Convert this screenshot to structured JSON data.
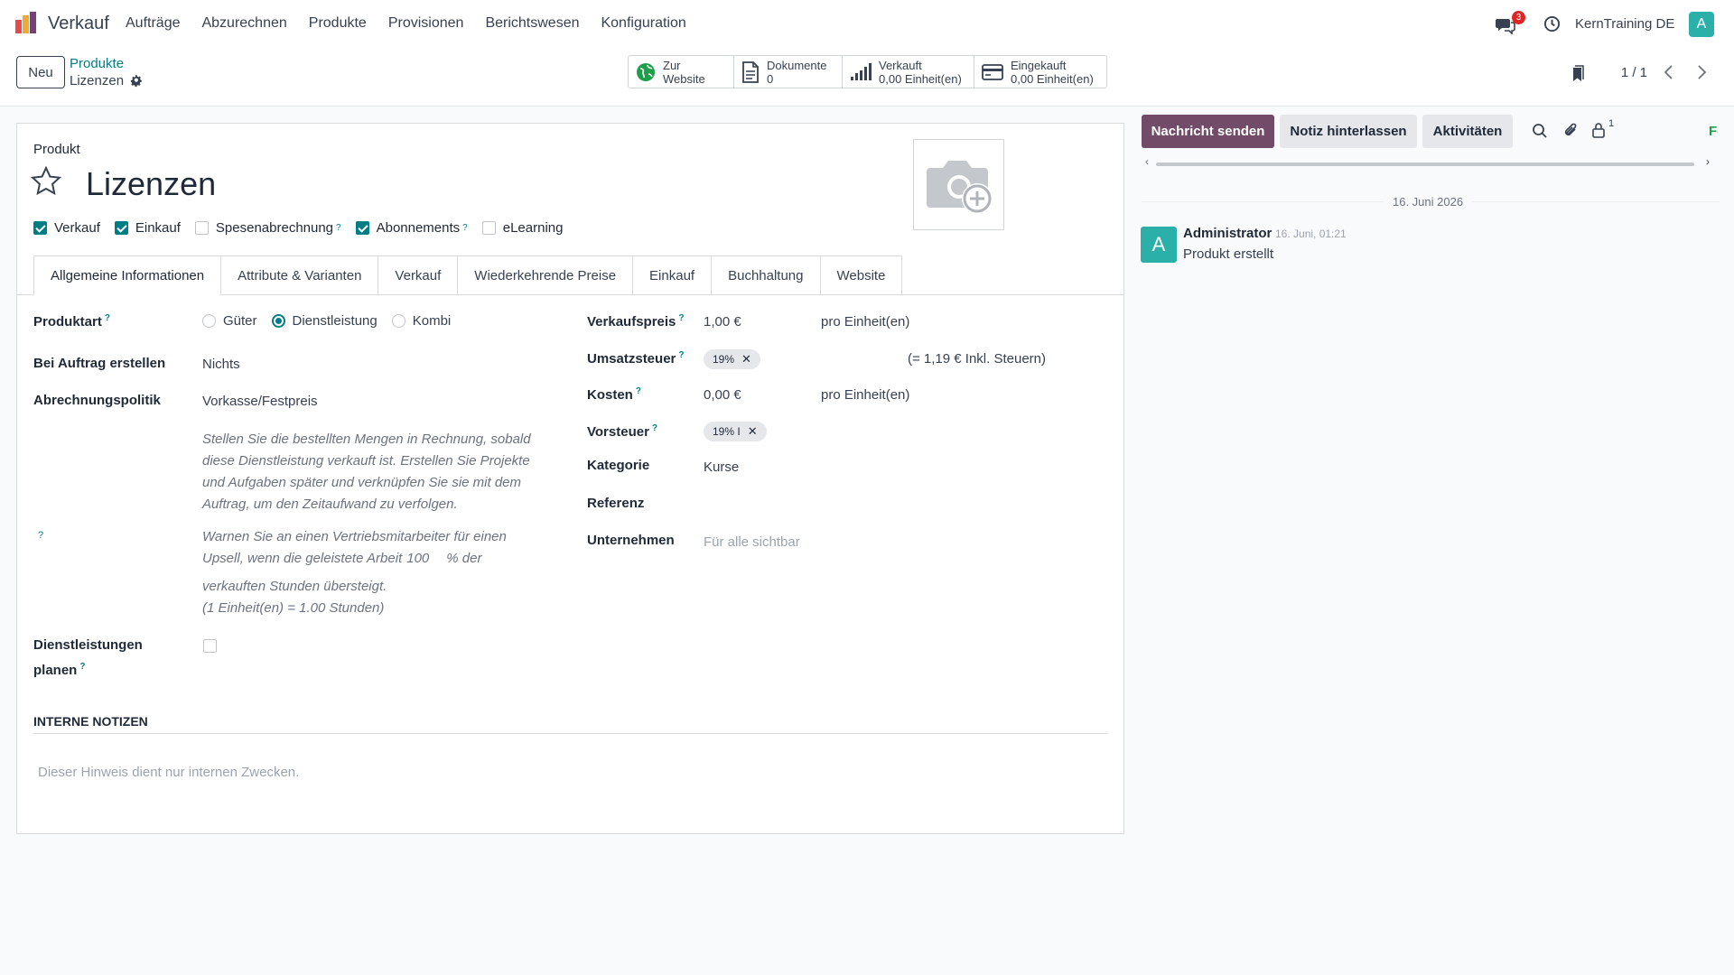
{
  "navbar": {
    "app_name": "Verkauf",
    "menu": [
      "Aufträge",
      "Abzurechnen",
      "Produkte",
      "Provisionen",
      "Berichtswesen",
      "Konfiguration"
    ],
    "messages_count": "3",
    "company": "KernTraining DE",
    "user_initial": "A",
    "icons": [
      "app-logo-icon",
      "chat-icon",
      "clock-icon"
    ]
  },
  "control": {
    "new_label": "Neu",
    "breadcrumb_parent": "Produkte",
    "breadcrumb_current": "Lizenzen",
    "smart_buttons": [
      {
        "line1": "Zur",
        "line2": "Website",
        "icon": "globe-icon"
      },
      {
        "line1": "Dokumente",
        "line2": "0",
        "icon": "document-icon"
      },
      {
        "line1": "Verkauft",
        "line2": "0,00 Einheit(en)",
        "icon": "bar-chart-icon"
      },
      {
        "line1": "Eingekauft",
        "line2": "0,00 Einheit(en)",
        "icon": "credit-card-icon"
      }
    ],
    "pager": "1 / 1"
  },
  "form": {
    "overline": "Produkt",
    "title": "Lizenzen",
    "options": [
      {
        "label": "Verkauf",
        "checked": true,
        "help": false
      },
      {
        "label": "Einkauf",
        "checked": true,
        "help": false
      },
      {
        "label": "Spesenabrechnung",
        "checked": false,
        "help": true
      },
      {
        "label": "Abonnements",
        "checked": true,
        "help": true
      },
      {
        "label": "eLearning",
        "checked": false,
        "help": false
      }
    ],
    "help_mark": "?",
    "tabs": [
      "Allgemeine Informationen",
      "Attribute & Varianten",
      "Verkauf",
      "Wiederkehrende Preise",
      "Einkauf",
      "Buchhaltung",
      "Website"
    ],
    "left": {
      "produktart_label": "Produktart",
      "produktart_options": [
        "Güter",
        "Dienstleistung",
        "Kombi"
      ],
      "produktart_selected": "Dienstleistung",
      "auftrag_label": "Bei Auftrag erstellen",
      "auftrag_value": "Nichts",
      "abrechnung_label": "Abrechnungspolitik",
      "abrechnung_value": "Vorkasse/Festpreis",
      "abrechnung_hint": [
        "Stellen Sie die bestellten Mengen in Rechnung, sobald",
        "diese Dienstleistung verkauft ist. Erstellen Sie Projekte",
        "und Aufgaben später und verknüpfen Sie sie mit dem",
        "Auftrag, um den Zeitaufwand zu verfolgen."
      ],
      "upsell_line1": "Warnen Sie an einen Vertriebsmitarbeiter für einen",
      "upsell_line2a": "Upsell, wenn die geleistete Arbeit",
      "upsell_value": "100",
      "upsell_line2b": "% der",
      "upsell_line3": "verkauften Stunden übersteigt.",
      "upsell_line4": "(1 Einheit(en) = 1.00 Stunden)",
      "planen_label_1": "Dienstleistungen",
      "planen_label_2": "planen"
    },
    "right": {
      "verkaufspreis_label": "Verkaufspreis",
      "verkaufspreis_value": "1,00 €",
      "verkaufspreis_unit": "pro Einheit(en)",
      "umsatzsteuer_label": "Umsatzsteuer",
      "umsatzsteuer_tag": "19%",
      "umsatzsteuer_incl": "(= 1,19 € Inkl. Steuern)",
      "kosten_label": "Kosten",
      "kosten_value": "0,00 €",
      "kosten_unit": "pro Einheit(en)",
      "vorsteuer_label": "Vorsteuer",
      "vorsteuer_tag": "19% I",
      "kategorie_label": "Kategorie",
      "kategorie_value": "Kurse",
      "referenz_label": "Referenz",
      "unternehmen_label": "Unternehmen",
      "unternehmen_placeholder": "Für alle sichtbar"
    },
    "notes_heading": "INTERNE NOTIZEN",
    "notes_placeholder": "Dieser Hinweis dient nur internen Zwecken."
  },
  "chatter": {
    "send_message": "Nachricht senden",
    "log_note": "Notiz hinterlassen",
    "activities": "Aktivitäten",
    "followers_count": "1",
    "follow_cut": "Fo",
    "date_separator": "16. Juni 2026",
    "message": {
      "author_initial": "A",
      "author": "Administrator",
      "time": "16. Juni, 01:21",
      "body": "Produkt erstellt"
    }
  },
  "colors": {
    "primary": "#714b67",
    "link": "#017e84",
    "avatar": "#2bb0a9"
  }
}
